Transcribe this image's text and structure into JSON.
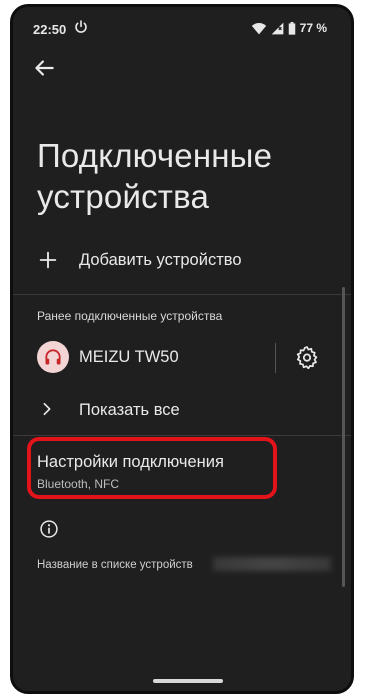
{
  "status_bar": {
    "time": "22:50",
    "battery": "77 %"
  },
  "header": {
    "title": "Подключенные устройства"
  },
  "add_device": {
    "label": "Добавить устройство"
  },
  "previously_connected": {
    "header": "Ранее подключенные устройства",
    "devices": [
      {
        "name": "MEIZU TW50",
        "icon": "headphones-icon"
      }
    ],
    "show_all_label": "Показать все"
  },
  "connection_settings": {
    "title": "Настройки подключения",
    "subtitle": "Bluetooth, NFC"
  },
  "device_name": {
    "label": "Название в списке устройств"
  },
  "colors": {
    "background": "#1f1f1f",
    "highlight": "#e3131b",
    "text": "#e9e9e9",
    "avatar_bg": "#f4d5d5",
    "avatar_fg": "#c62828"
  }
}
